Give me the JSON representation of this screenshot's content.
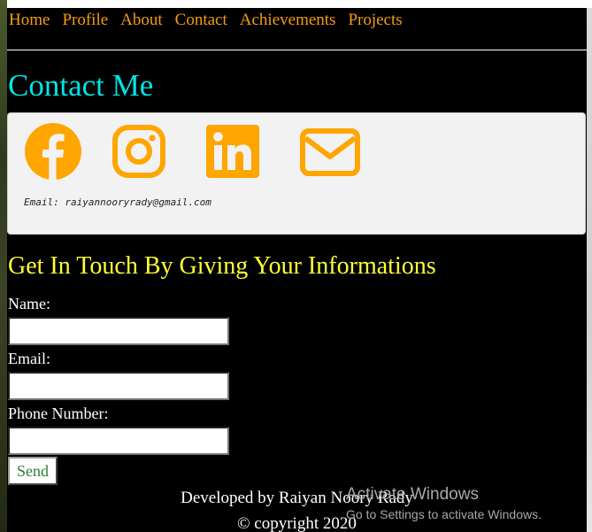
{
  "nav": {
    "items": [
      "Home",
      "Profile",
      "About",
      "Contact",
      "Achievements",
      "Projects"
    ]
  },
  "contact": {
    "title": "Contact Me",
    "icons": [
      "facebook-icon",
      "instagram-icon",
      "linkedin-icon",
      "mail-icon"
    ],
    "email_line": "Email: raiyannooryrady@gmail.com"
  },
  "form": {
    "heading": "Get In Touch By Giving Your Informations",
    "name_label": "Name:",
    "name_value": "",
    "email_label": "Email:",
    "email_value": "",
    "phone_label": "Phone Number:",
    "phone_value": "",
    "send_label": "Send"
  },
  "footer": {
    "developed_by": "Developed by Raiyan Noory Rady",
    "copyright": "© copyright 2020"
  },
  "watermark": {
    "title": "Activate Windows",
    "subtitle": "Go to Settings to activate Windows."
  },
  "colors": {
    "nav_link": "#f39c12",
    "title": "#00e5e5",
    "form_heading": "#ffff33",
    "icon": "#ffa500",
    "background": "#000000"
  }
}
